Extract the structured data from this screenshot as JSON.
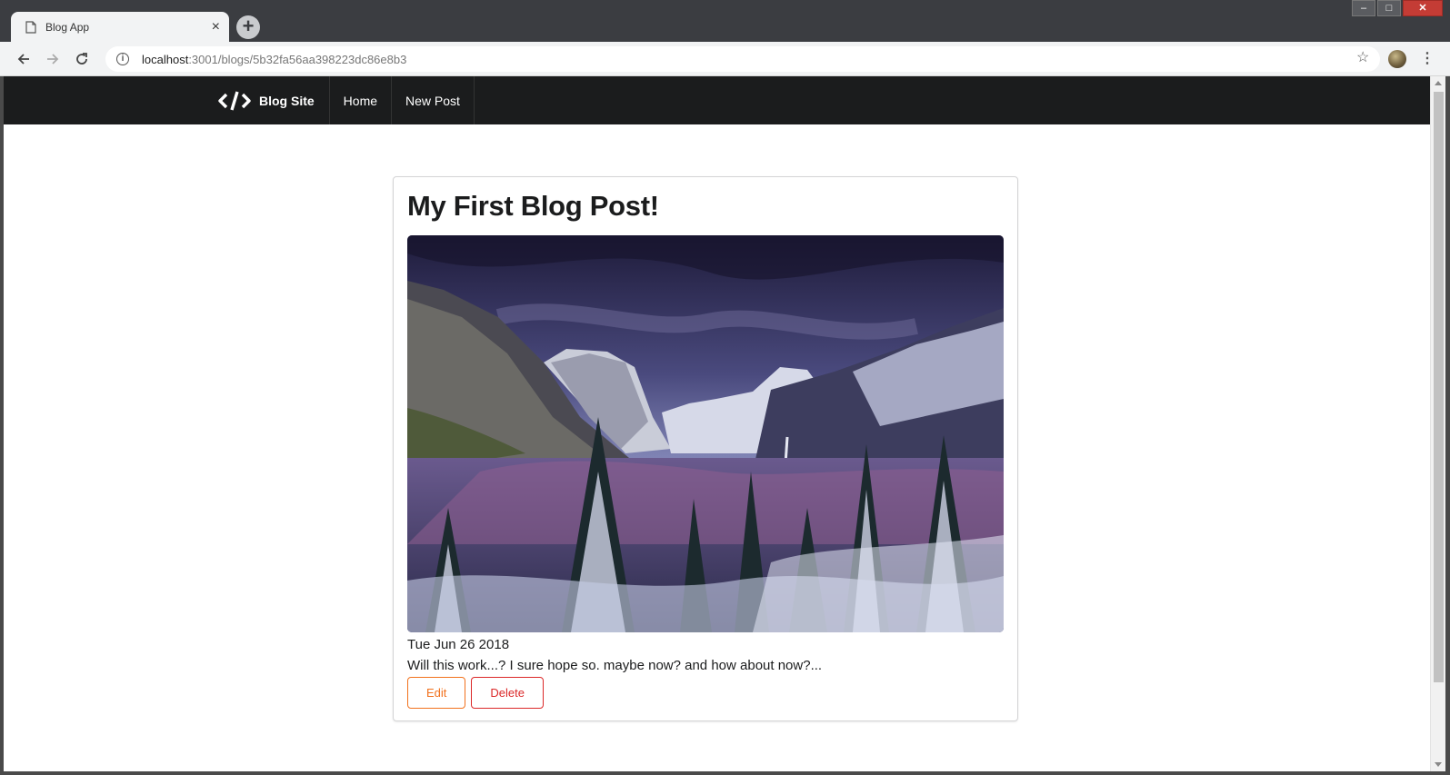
{
  "browser": {
    "tab_title": "Blog App",
    "url_host": "localhost",
    "url_path": ":3001/blogs/5b32fa56aa398223dc86e8b3"
  },
  "site_nav": {
    "brand": "Blog Site",
    "items": [
      "Home",
      "New Post"
    ]
  },
  "post": {
    "title": "My First Blog Post!",
    "date": "Tue Jun 26 2018",
    "body": "Will this work...? I sure hope so. maybe now? and how about now?...",
    "edit_label": "Edit",
    "delete_label": "Delete"
  },
  "colors": {
    "navbar_bg": "#1b1c1d",
    "edit_accent": "#f2711c",
    "delete_accent": "#db2828"
  }
}
